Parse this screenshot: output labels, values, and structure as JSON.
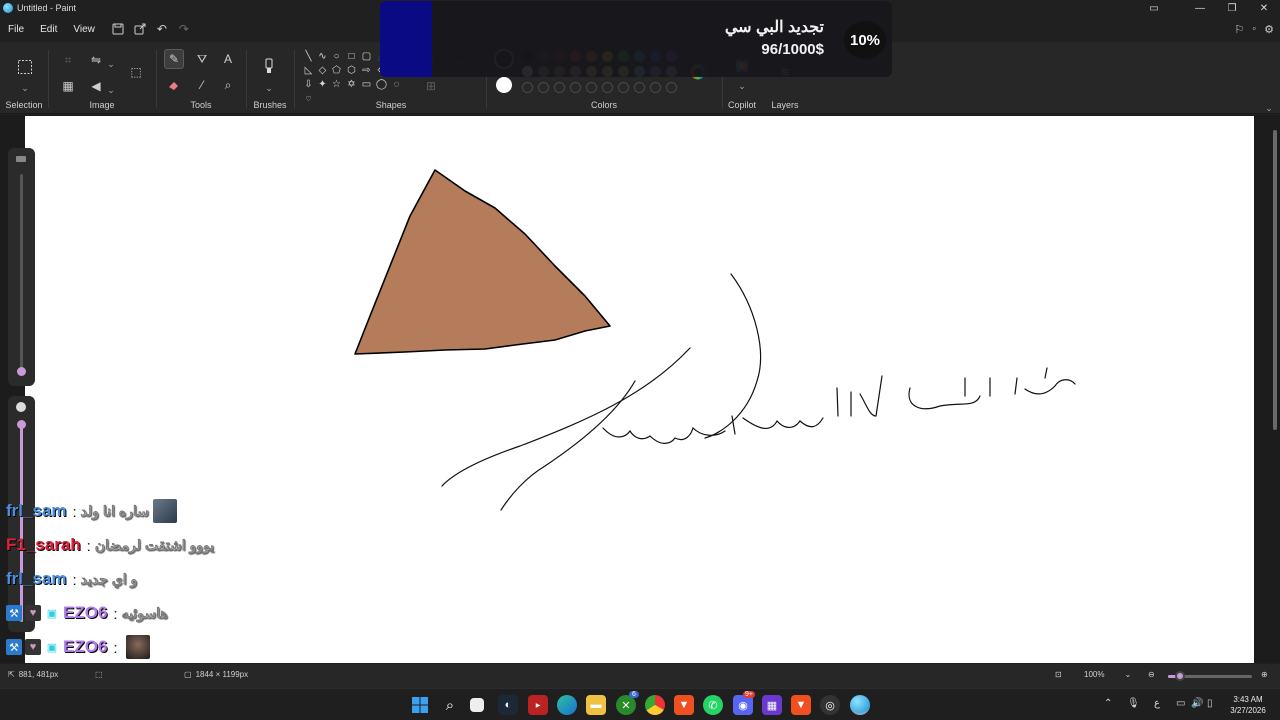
{
  "window": {
    "title": "Untitled - Paint"
  },
  "menu": {
    "file": "File",
    "edit": "Edit",
    "view": "View"
  },
  "ribbon": {
    "groups": {
      "selection": "Selection",
      "image": "Image",
      "tools": "Tools",
      "brushes": "Brushes",
      "shapes": "Shapes",
      "colors": "Colors",
      "copilot": "Copilot",
      "layers": "Layers"
    },
    "tools_text_glyph": "A",
    "palette_row1": [
      "#000000",
      "#404040",
      "#8a1a1a",
      "#e02020",
      "#e87020",
      "#e8c020",
      "#30b040",
      "#20a0c0",
      "#3050c0",
      "#8040b0"
    ],
    "palette_row2": [
      "#ffffff",
      "#a0a0a0",
      "#b07070",
      "#f0a0b0",
      "#f0c060",
      "#f0e080",
      "#b0e060",
      "#80e0f0",
      "#8090d0",
      "#c0a0d0"
    ]
  },
  "overlay": {
    "title": "تجديد البي سي",
    "progress": "96/1000$",
    "percent": "10%"
  },
  "canvas": {
    "triangle_fill": "#b57c5c",
    "handwriting": "عبدالله الاحمد الحربي"
  },
  "chat": [
    {
      "name": "frl_sam",
      "name_color": "#4a8fe0",
      "message": "ساره انا ولد",
      "avatar": true
    },
    {
      "name": "F1_sarah",
      "name_color": "#e0203a",
      "message": "يووو اشتقت لرمضان",
      "avatar": false
    },
    {
      "name": "frl_sam",
      "name_color": "#4a8fe0",
      "message": "و اي جديد",
      "avatar": false
    },
    {
      "name": "EZO6",
      "name_color": "#b07ae8",
      "message": "هاسوئيه",
      "avatar": false
    },
    {
      "name": "EZO6",
      "name_color": "#b07ae8",
      "message": "",
      "avatar": true
    }
  ],
  "status": {
    "cursor_position": "881, 481px",
    "canvas_size": "1844 × 1199px",
    "zoom": "100%"
  },
  "taskbar": {
    "time": "3:43 AM",
    "date": "3/27/2026",
    "lang": "ع",
    "badges": {
      "xbox": "6",
      "discord": "9+"
    }
  }
}
